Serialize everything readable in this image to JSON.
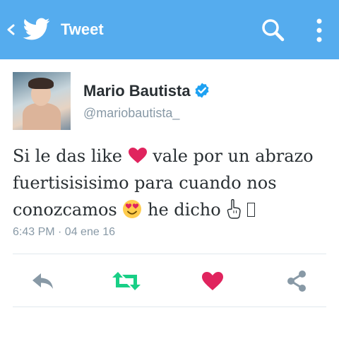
{
  "header": {
    "title": "Tweet"
  },
  "tweet": {
    "author_name": "Mario Bautista",
    "handle": "@mariobautista_",
    "text_part1": "Si le das like",
    "text_part2": "vale por un abrazo fuertisisisimo para cuando nos conozcamos",
    "text_part3": "he dicho",
    "timestamp": "6:43 PM · 04 ene 16"
  },
  "icons": {
    "back": "chevron-left-icon",
    "logo": "twitter-bird-icon",
    "search": "search-icon",
    "more": "more-vertical-icon",
    "verified": "verified-badge-icon",
    "reply": "reply-icon",
    "retweet": "retweet-icon",
    "like": "heart-icon",
    "share": "share-icon"
  },
  "colors": {
    "header": "#55acee",
    "retweet": "#19cf86",
    "like": "#e0245e",
    "verified": "#1da1f2",
    "muted": "#8899a6",
    "text": "#292f33"
  }
}
